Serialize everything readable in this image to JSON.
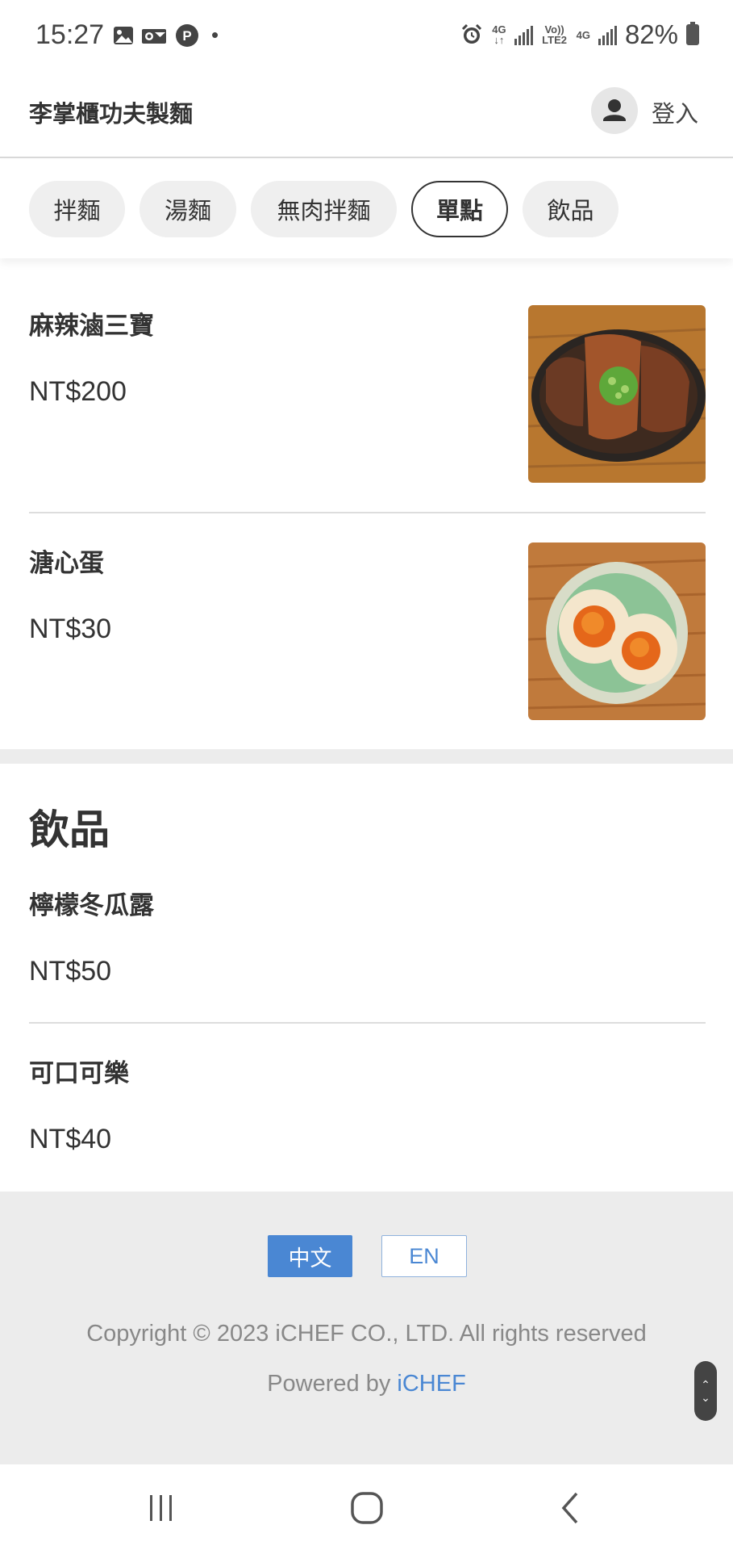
{
  "status_bar": {
    "time": "15:27",
    "dot": "•",
    "net1": "4G",
    "volte": "Vo)) LTE2",
    "net2": "4G",
    "battery": "82%"
  },
  "header": {
    "store_name": "李掌櫃功夫製麵",
    "login_label": "登入"
  },
  "tabs": [
    {
      "label": "拌麵",
      "active": false
    },
    {
      "label": "湯麵",
      "active": false
    },
    {
      "label": "無肉拌麵",
      "active": false
    },
    {
      "label": "單點",
      "active": true
    },
    {
      "label": "飲品",
      "active": false
    }
  ],
  "sections": {
    "single": {
      "items": [
        {
          "name": "麻辣滷三寶",
          "price": "NT$200",
          "image": "braised-beef-tripe-tendon"
        },
        {
          "name": "溏心蛋",
          "price": "NT$30",
          "image": "soft-boiled-eggs"
        }
      ]
    },
    "drinks": {
      "title": "飲品",
      "items": [
        {
          "name": "檸檬冬瓜露",
          "price": "NT$50"
        },
        {
          "name": "可口可樂",
          "price": "NT$40"
        }
      ]
    }
  },
  "footer": {
    "lang_zh": "中文",
    "lang_en": "EN",
    "copyright": "Copyright © 2023 iCHEF CO., LTD. All rights reserved",
    "powered_by": "Powered by",
    "powered_brand": "iCHEF"
  },
  "colors": {
    "accent": "#4a87d3",
    "footer_bg": "#ececec"
  }
}
